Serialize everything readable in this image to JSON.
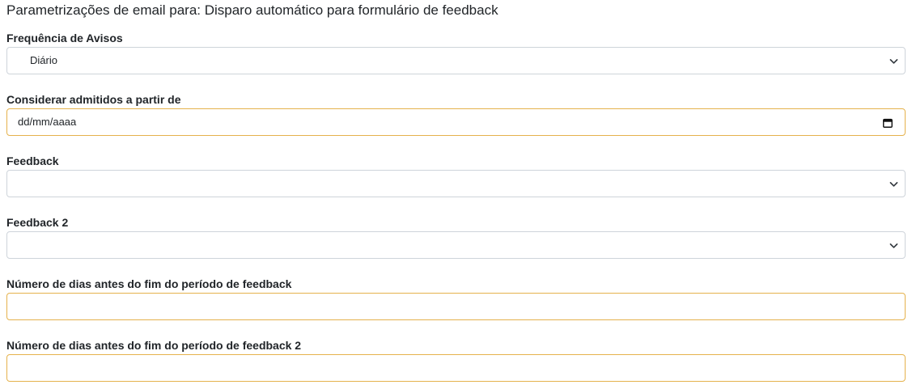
{
  "page": {
    "title": "Parametrizações de email para: Disparo automático para formulário de feedback"
  },
  "fields": {
    "frequencia": {
      "label": "Frequência de Avisos",
      "value": "Diário"
    },
    "admitidos": {
      "label": "Considerar admitidos a partir de",
      "placeholder": "dd/mm/aaaa"
    },
    "feedback": {
      "label": "Feedback",
      "value": ""
    },
    "feedback2": {
      "label": "Feedback 2",
      "value": ""
    },
    "dias_feedback": {
      "label": "Número de dias antes do fim do período de feedback",
      "value": ""
    },
    "dias_feedback2": {
      "label": "Número de dias antes do fim do período de feedback 2",
      "value": ""
    }
  },
  "icons": {
    "select": "chevron-down-icon",
    "date": "calendar-icon"
  },
  "colors": {
    "focus_border": "#e5b24c",
    "default_border": "#ced4da",
    "text": "#212529"
  }
}
